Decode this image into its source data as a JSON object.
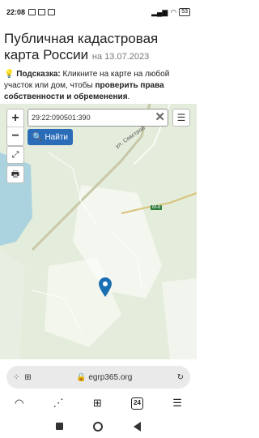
{
  "status_bar": {
    "time": "22:08",
    "battery": "53"
  },
  "header": {
    "title": "Публичная кадастровая карта России",
    "date": "на 13.07.2023",
    "hint_label": "Подсказка:",
    "hint_text": " Кликните на карте на любой участок или дом, чтобы ",
    "hint_bold": "проверить права собственности и обременения",
    "hint_end": "."
  },
  "map": {
    "search": {
      "value": "29:22:090501:390"
    },
    "find_label": "Найти",
    "zoom_in": "+",
    "zoom_out": "−",
    "road_label": "ул. Севстрой",
    "highway_badge": "М-8",
    "pin_color": "#1a6fb3"
  },
  "browser": {
    "url": "egrp365.org",
    "tab_count": "24"
  }
}
